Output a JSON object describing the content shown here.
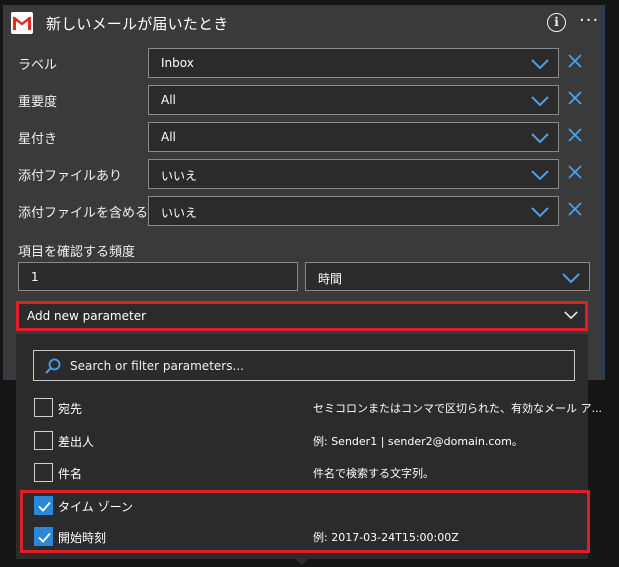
{
  "header": {
    "title": "新しいメールが届いたとき",
    "logo": "gmail-icon",
    "info_icon": "info-icon",
    "more_icon": "more-icon"
  },
  "fields": [
    {
      "label": "ラベル",
      "value": "Inbox"
    },
    {
      "label": "重要度",
      "value": "All"
    },
    {
      "label": "星付き",
      "value": "All"
    },
    {
      "label": "添付ファイルあり",
      "value": "いいえ"
    },
    {
      "label": "添付ファイルを含める",
      "value": "いいえ"
    }
  ],
  "frequency": {
    "label": "項目を確認する頻度",
    "interval": "1",
    "unit": "時間"
  },
  "add_param": {
    "label": "Add new parameter"
  },
  "dropdown": {
    "search_placeholder": "Search or filter parameters...",
    "options": [
      {
        "name": "宛先",
        "description": "セミコロンまたはコンマで区切られた、有効なメール ア...",
        "checked": false
      },
      {
        "name": "差出人",
        "description": "例: Sender1 | sender2@domain.com。",
        "checked": false
      },
      {
        "name": "件名",
        "description": "件名で検索する文字列。",
        "checked": false
      },
      {
        "name": "タイム ゾーン",
        "description": "",
        "checked": true
      },
      {
        "name": "開始時刻",
        "description": "例: 2017-03-24T15:00:00Z",
        "checked": true
      }
    ]
  },
  "colors": {
    "accent": "#2b88d8",
    "highlight": "#e01e26",
    "card_bg": "#3a3a3a",
    "input_bg": "#2b2b2b"
  }
}
